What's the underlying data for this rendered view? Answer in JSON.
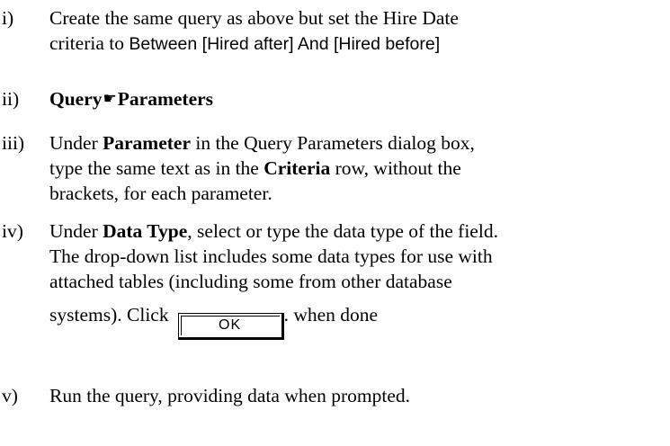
{
  "steps": [
    {
      "number": "i)",
      "line1": "Create the same query as above but set the Hire Date",
      "line2_prefix": "criteria to ",
      "line2_criteria": "Between [Hired after] And [Hired before]"
    },
    {
      "number": "ii)",
      "menu_part1": "Query",
      "menu_separator_icon": "pointing-hand-icon",
      "menu_separator_glyph": "☛",
      "menu_part2": "Parameters"
    },
    {
      "number": "iii)",
      "line1_pre": "Under ",
      "line1_bold": "Parameter",
      "line1_post": " in the Query Parameters dialog box,",
      "line2_pre": "type the same text as in the ",
      "line2_bold": "Criteria",
      "line2_post": " row, without the",
      "line3": "brackets, for each parameter."
    },
    {
      "number": "iv)",
      "line1_pre": "Under ",
      "line1_bold": "Data Type",
      "line1_post": ", select or type the data type of the field.",
      "line2": "The drop-down list includes some data types for use with",
      "line3": "attached tables (including some from other database",
      "line4_pre": "systems). Click",
      "ok_button_label": "OK",
      "line4_post": ". when done"
    },
    {
      "number": "v)",
      "line1": "Run the query, providing data when prompted."
    }
  ]
}
